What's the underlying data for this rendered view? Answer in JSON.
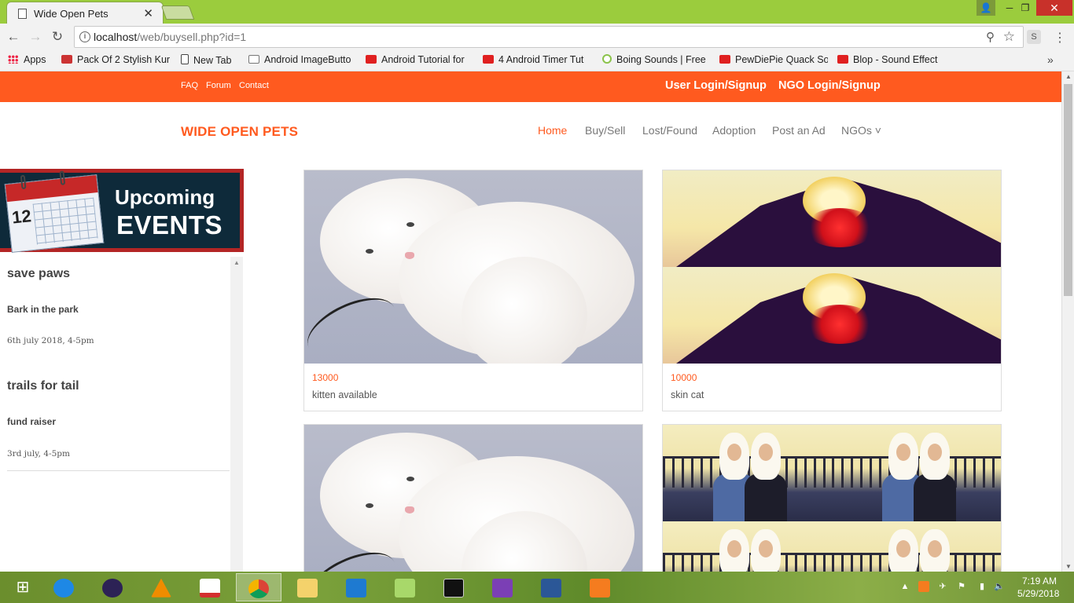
{
  "browser": {
    "tab_title": "Wide Open Pets",
    "url_host": "localhost",
    "url_path": "/web/buysell.php?id=1",
    "extension_label": "S",
    "bookmarks": [
      {
        "label": "Apps",
        "icon": "apps-grid-icon"
      },
      {
        "label": "Pack Of 2 Stylish Kur",
        "icon": "shop-icon"
      },
      {
        "label": "New Tab",
        "icon": "page-icon"
      },
      {
        "label": "Android ImageButto",
        "icon": "gear-icon"
      },
      {
        "label": "Android Tutorial for",
        "icon": "youtube-icon"
      },
      {
        "label": "4 Android Timer Tut",
        "icon": "youtube-icon"
      },
      {
        "label": "Boing Sounds | Free",
        "icon": "sound-icon"
      },
      {
        "label": "PewDiePie Quack So",
        "icon": "youtube-icon"
      },
      {
        "label": "Blop - Sound Effect",
        "icon": "youtube-icon"
      }
    ],
    "bookmarks_more": "»"
  },
  "topbar": {
    "links": [
      "FAQ",
      "Forum",
      "Contact"
    ],
    "user_login": "User Login/Signup",
    "ngo_login": "NGO Login/Signup",
    "accent": "#ff5a1f"
  },
  "header": {
    "brand": "WIDE OPEN PETS",
    "nav": [
      {
        "label": "Home",
        "active": true
      },
      {
        "label": "Buy/Sell",
        "active": false
      },
      {
        "label": "Lost/Found",
        "active": false
      },
      {
        "label": "Adoption",
        "active": false
      },
      {
        "label": "Post an Ad",
        "active": false
      },
      {
        "label": "NGOs ˅",
        "active": false
      }
    ]
  },
  "sidebar": {
    "banner_day": "12",
    "banner_line1": "Upcoming",
    "banner_line2": "EVENTS",
    "events": [
      {
        "title": "save paws",
        "subtitle": "Bark in the park",
        "date": "6th july 2018, 4-5pm"
      },
      {
        "title": "trails for tail",
        "subtitle": "fund raiser",
        "date": "3rd july, 4-5pm"
      }
    ]
  },
  "listings": [
    {
      "price": "13000",
      "name": "kitten available",
      "image": "white-kitten"
    },
    {
      "price": "10000",
      "name": "skin cat",
      "image": "heart-sunset"
    },
    {
      "price": "",
      "name": "",
      "image": "white-kitten"
    },
    {
      "price": "",
      "name": "",
      "image": "two-women"
    }
  ],
  "taskbar": {
    "apps": [
      "windows-start-icon",
      "ie-icon",
      "eclipse-icon",
      "vlc-icon",
      "popcorn-icon",
      "chrome-icon",
      "file-explorer-icon",
      "vscode-icon",
      "notes-icon",
      "cmd-icon",
      "visual-studio-icon",
      "word-icon",
      "xampp-icon"
    ],
    "time": "7:19 AM",
    "date": "5/29/2018"
  }
}
